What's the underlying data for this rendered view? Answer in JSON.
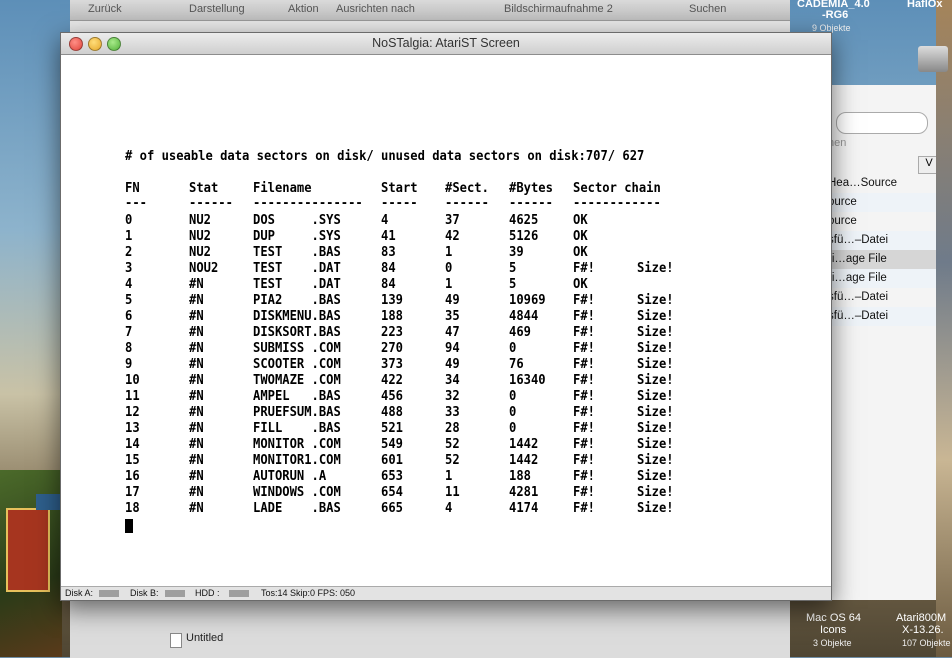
{
  "finder": {
    "toolbar": {
      "back": "Zurück",
      "view": "Darstellung",
      "action": "Aktion",
      "arrange": "Ausrichten nach",
      "title": "Bildschirmaufnahme 2",
      "search": "Suchen"
    },
    "bottom_item": "Untitled",
    "side_search_placeholder": "hen",
    "side_header": "V",
    "side_rows": [
      "Hea…Source",
      "ource",
      "ource",
      "sfü…–Datei",
      "ri…age File",
      "ri…age File",
      "sfü…–Datei",
      "sfü…–Datei"
    ]
  },
  "desktop": {
    "top_label_1": "CADEMIA_4.0",
    "top_label_1b": "-RG6",
    "top_label_1c": "9 Objekte",
    "top_label_2": "HaflOx",
    "bottom_label_1": "Mac OS 64",
    "bottom_label_1b": "Icons",
    "bottom_label_1c": "3 Objekte",
    "bottom_label_2": "Atari800M",
    "bottom_label_2b": "X-13.26.",
    "bottom_label_2c": "107 Objekte"
  },
  "window": {
    "title": "NoSTalgia: AtariST Screen",
    "buttons": [
      "close",
      "minimize",
      "zoom"
    ]
  },
  "screen": {
    "summary": "# of useable data sectors on disk/ unused data sectors on disk:707/ 627",
    "headers": [
      "FN",
      "Stat",
      "Filename",
      "Start",
      "#Sect.",
      "#Bytes",
      "Sector chain"
    ],
    "underlines": [
      "---",
      "------",
      "---------------",
      "-----",
      "------",
      "------",
      "------------"
    ],
    "rows": [
      [
        "0",
        "NU2",
        "DOS     .SYS",
        "4",
        "37",
        "4625",
        "OK",
        ""
      ],
      [
        "1",
        "NU2",
        "DUP     .SYS",
        "41",
        "42",
        "5126",
        "OK",
        ""
      ],
      [
        "2",
        "NU2",
        "TEST    .BAS",
        "83",
        "1",
        "39",
        "OK",
        ""
      ],
      [
        "3",
        "NOU2",
        "TEST    .DAT",
        "84",
        "0",
        "5",
        "F#!",
        "Size!"
      ],
      [
        "4",
        "#N",
        "TEST    .DAT",
        "84",
        "1",
        "5",
        "OK",
        ""
      ],
      [
        "5",
        "#N",
        "PIA2    .BAS",
        "139",
        "49",
        "10969",
        "F#!",
        "Size!"
      ],
      [
        "6",
        "#N",
        "DISKMENU.BAS",
        "188",
        "35",
        "4844",
        "F#!",
        "Size!"
      ],
      [
        "7",
        "#N",
        "DISKSORT.BAS",
        "223",
        "47",
        "469",
        "F#!",
        "Size!"
      ],
      [
        "8",
        "#N",
        "SUBMISS .COM",
        "270",
        "94",
        "0",
        "F#!",
        "Size!"
      ],
      [
        "9",
        "#N",
        "SCOOTER .COM",
        "373",
        "49",
        "76",
        "F#!",
        "Size!"
      ],
      [
        "10",
        "#N",
        "TWOMAZE .COM",
        "422",
        "34",
        "16340",
        "F#!",
        "Size!"
      ],
      [
        "11",
        "#N",
        "AMPEL   .BAS",
        "456",
        "32",
        "0",
        "F#!",
        "Size!"
      ],
      [
        "12",
        "#N",
        "PRUEFSUM.BAS",
        "488",
        "33",
        "0",
        "F#!",
        "Size!"
      ],
      [
        "13",
        "#N",
        "FILL    .BAS",
        "521",
        "28",
        "0",
        "F#!",
        "Size!"
      ],
      [
        "14",
        "#N",
        "MONITOR .COM",
        "549",
        "52",
        "1442",
        "F#!",
        "Size!"
      ],
      [
        "15",
        "#N",
        "MONITOR1.COM",
        "601",
        "52",
        "1442",
        "F#!",
        "Size!"
      ],
      [
        "16",
        "#N",
        "AUTORUN .A",
        "653",
        "1",
        "188",
        "F#!",
        "Size!"
      ],
      [
        "17",
        "#N",
        "WINDOWS .COM",
        "654",
        "11",
        "4281",
        "F#!",
        "Size!"
      ],
      [
        "18",
        "#N",
        "LADE    .BAS",
        "665",
        "4",
        "4174",
        "F#!",
        "Size!"
      ]
    ]
  },
  "statusbar": {
    "disk_a": "Disk A:",
    "disk_b": "Disk B:",
    "hdd": "HDD  :",
    "info": "Tos:14 Skip:0 FPS: 050"
  }
}
